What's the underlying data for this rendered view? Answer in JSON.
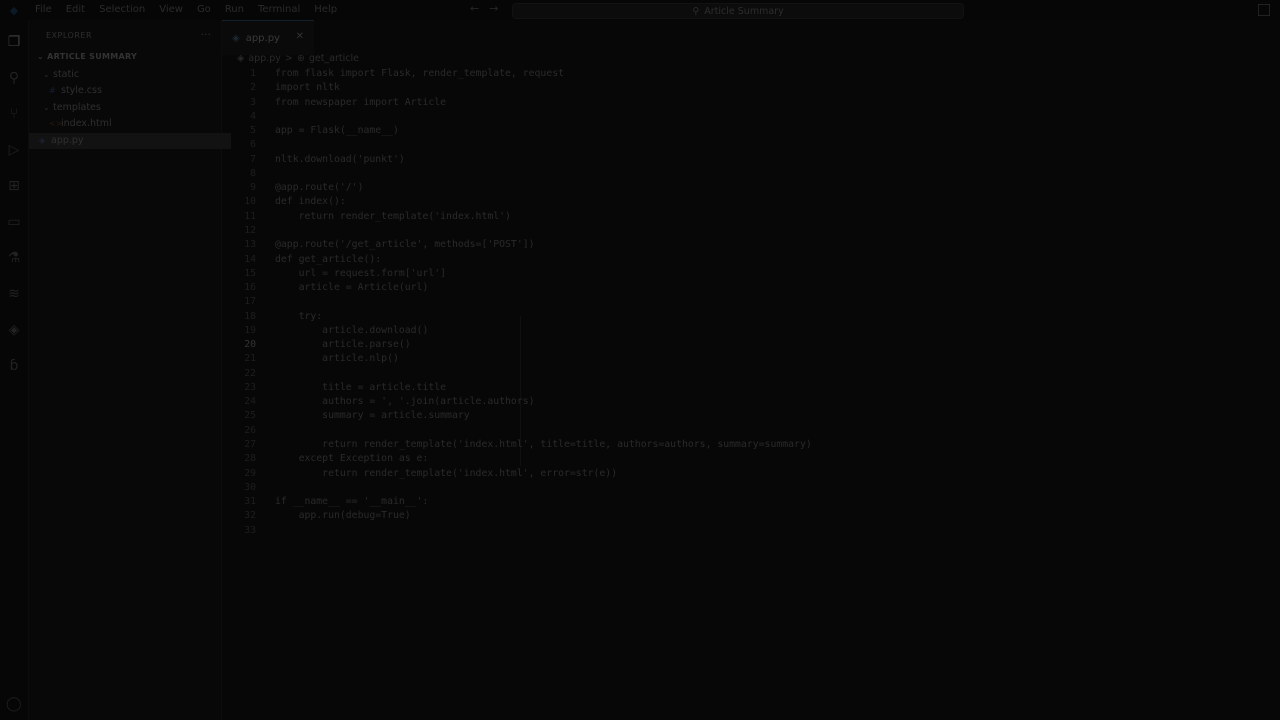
{
  "titlebar": {
    "menu": [
      "File",
      "Edit",
      "Selection",
      "View",
      "Go",
      "Run",
      "Terminal",
      "Help"
    ],
    "search_label": "Article Summary"
  },
  "explorer": {
    "title": "EXPLORER",
    "section": "ARTICLE SUMMARY",
    "tree": [
      {
        "label": "static",
        "type": "folder",
        "expanded": true
      },
      {
        "label": "style.css",
        "type": "file"
      },
      {
        "label": "templates",
        "type": "folder",
        "expanded": true
      },
      {
        "label": "index.html",
        "type": "file"
      },
      {
        "label": "app.py",
        "type": "file",
        "selected": true
      }
    ]
  },
  "editor": {
    "tab_label": "app.py",
    "breadcrumb": [
      "app.py",
      ">",
      "get_article"
    ],
    "current_line": 20,
    "line_numbers": [
      "1",
      "2",
      "3",
      "4",
      "5",
      "6",
      "7",
      "8",
      "9",
      "10",
      "11",
      "12",
      "13",
      "14",
      "15",
      "16",
      "17",
      "18",
      "19",
      "20",
      "21",
      "22",
      "23",
      "24",
      "25",
      "26",
      "27",
      "28",
      "29",
      "30",
      "31",
      "32",
      "33"
    ],
    "lines": [
      "from flask import Flask, render_template, request",
      "import nltk",
      "from newspaper import Article",
      "",
      "app = Flask(__name__)",
      "",
      "nltk.download('punkt')",
      "",
      "@app.route('/')",
      "def index():",
      "    return render_template('index.html')",
      "",
      "@app.route('/get_article', methods=['POST'])",
      "def get_article():",
      "    url = request.form['url']",
      "    article = Article(url)",
      "",
      "    try:",
      "        article.download()",
      "        article.parse()",
      "        article.nlp()",
      "",
      "        title = article.title",
      "        authors = ', '.join(article.authors)",
      "        summary = article.summary",
      "",
      "        return render_template('index.html', title=title, authors=authors, summary=summary)",
      "    except Exception as e:",
      "        return render_template('index.html', error=str(e))",
      "",
      "if __name__ == '__main__':",
      "    app.run(debug=True)",
      ""
    ]
  }
}
